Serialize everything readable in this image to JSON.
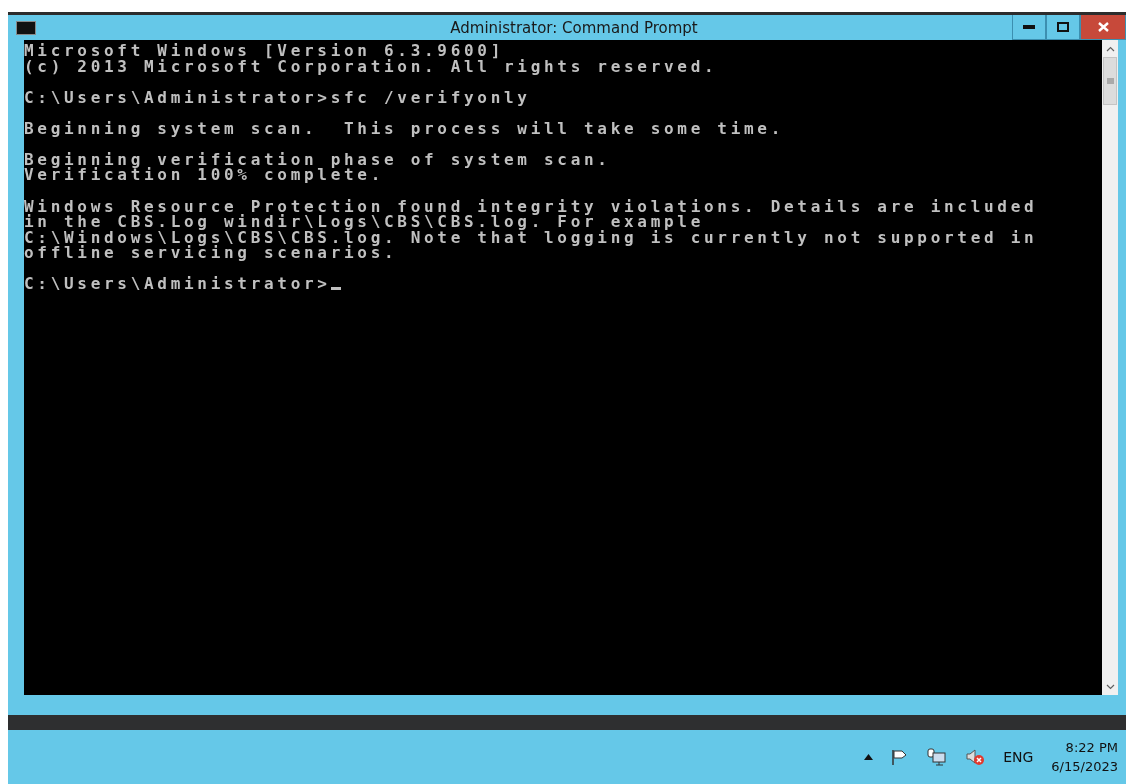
{
  "window": {
    "title": "Administrator: Command Prompt"
  },
  "console": {
    "blocks": [
      [
        "Microsoft Windows [Version 6.3.9600]",
        "(c) 2013 Microsoft Corporation. All rights reserved."
      ],
      [
        "C:\\Users\\Administrator>sfc /verifyonly"
      ],
      [
        "Beginning system scan.  This process will take some time."
      ],
      [
        "Beginning verification phase of system scan.",
        "Verification 100% complete."
      ],
      [
        "Windows Resource Protection found integrity violations. Details are included",
        "in the CBS.Log windir\\Logs\\CBS\\CBS.log. For example",
        "C:\\Windows\\Logs\\CBS\\CBS.log. Note that logging is currently not supported in",
        "offline servicing scenarios."
      ]
    ],
    "prompt": "C:\\Users\\Administrator>"
  },
  "taskbar": {
    "language": "ENG",
    "time": "8:22 PM",
    "date": "6/15/2023"
  }
}
